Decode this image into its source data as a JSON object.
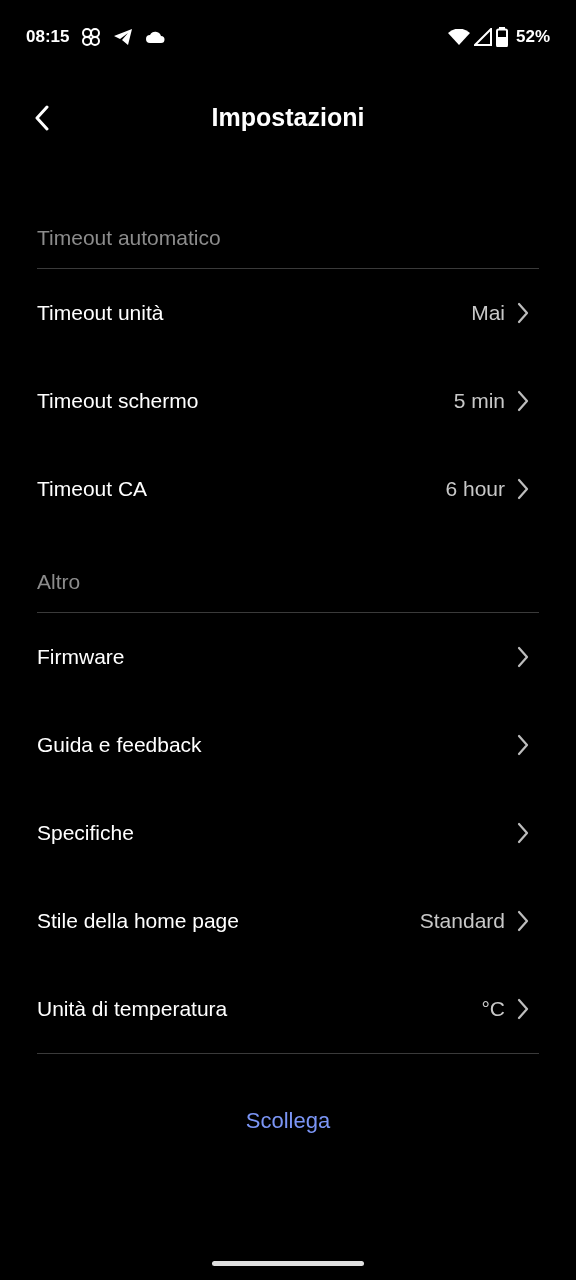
{
  "status_bar": {
    "time": "08:15",
    "battery": "52%"
  },
  "header": {
    "title": "Impostazioni"
  },
  "sections": [
    {
      "title": "Timeout automatico",
      "rows": [
        {
          "label": "Timeout unità",
          "value": "Mai"
        },
        {
          "label": "Timeout schermo",
          "value": "5 min"
        },
        {
          "label": "Timeout CA",
          "value": "6 hour"
        }
      ]
    },
    {
      "title": "Altro",
      "rows": [
        {
          "label": "Firmware"
        },
        {
          "label": "Guida e feedback"
        },
        {
          "label": "Specifiche"
        },
        {
          "label": "Stile della home page",
          "value": "Standard"
        },
        {
          "label": "Unità di temperatura",
          "value": "°C"
        }
      ]
    }
  ],
  "disconnect": "Scollega"
}
